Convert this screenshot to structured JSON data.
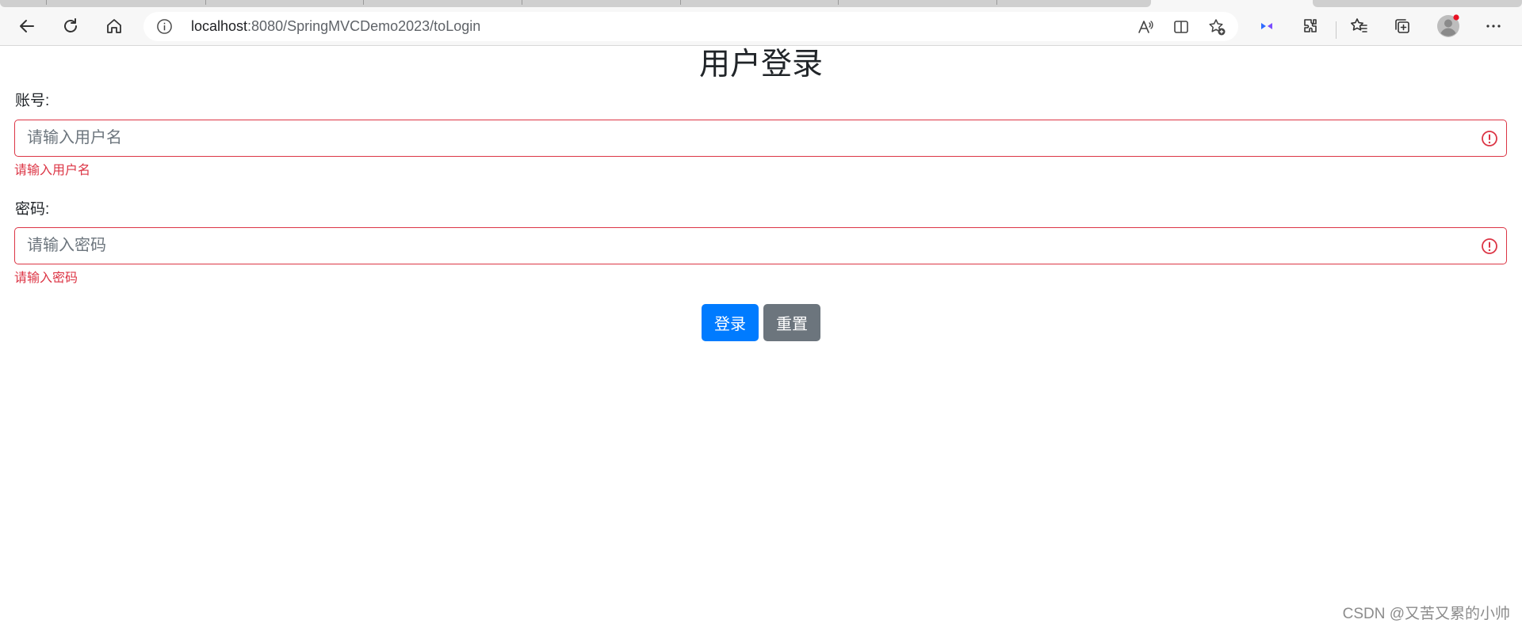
{
  "browser": {
    "url_host": "localhost",
    "url_rest": ":8080/SpringMVCDemo2023/toLogin",
    "icons": [
      "back-icon",
      "refresh-icon",
      "home-icon",
      "site-info-icon",
      "read-aloud-icon",
      "split-screen-icon",
      "add-favorite-icon",
      "extension-colored-icon",
      "extensions-icon",
      "favorites-icon",
      "collections-icon",
      "profile-icon",
      "more-icon"
    ]
  },
  "login": {
    "title": "用户登录",
    "username_label": "账号:",
    "username_placeholder": "请输入用户名",
    "username_value": "",
    "username_error": "请输入用户名",
    "password_label": "密码:",
    "password_placeholder": "请输入密码",
    "password_value": "",
    "password_error": "请输入密码",
    "submit_label": "登录",
    "reset_label": "重置"
  },
  "watermark": "CSDN @又苦又累的小帅",
  "colors": {
    "primary": "#007bff",
    "secondary": "#6c757d",
    "danger": "#dc3545",
    "toolbar": "#f7f7f7",
    "profile_badge": "#e81123"
  }
}
